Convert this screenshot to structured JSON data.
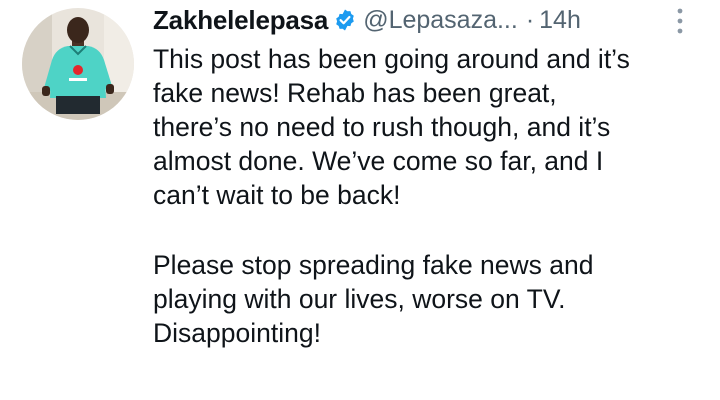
{
  "tweet": {
    "author": {
      "display_name": "Zakhelelepasa",
      "handle": "@Lepasaza...",
      "verified": true,
      "avatar_icon": "profile-photo"
    },
    "separator": "·",
    "timestamp": "14h",
    "more_icon": "ellipsis-vertical-icon",
    "text_lines": [
      "This post has been going around and it’s",
      "fake news! Rehab has been great,",
      "there’s no need to rush though, and it’s",
      "almost done. We’ve come so far, and I",
      "can’t wait to be back!",
      "Please stop spreading fake news and",
      "playing with our lives, worse on TV.",
      "Disappointing!"
    ]
  },
  "colors": {
    "text_primary": "#0f1419",
    "text_secondary": "#536471",
    "verified_blue": "#1d9bf0",
    "background": "#ffffff"
  }
}
